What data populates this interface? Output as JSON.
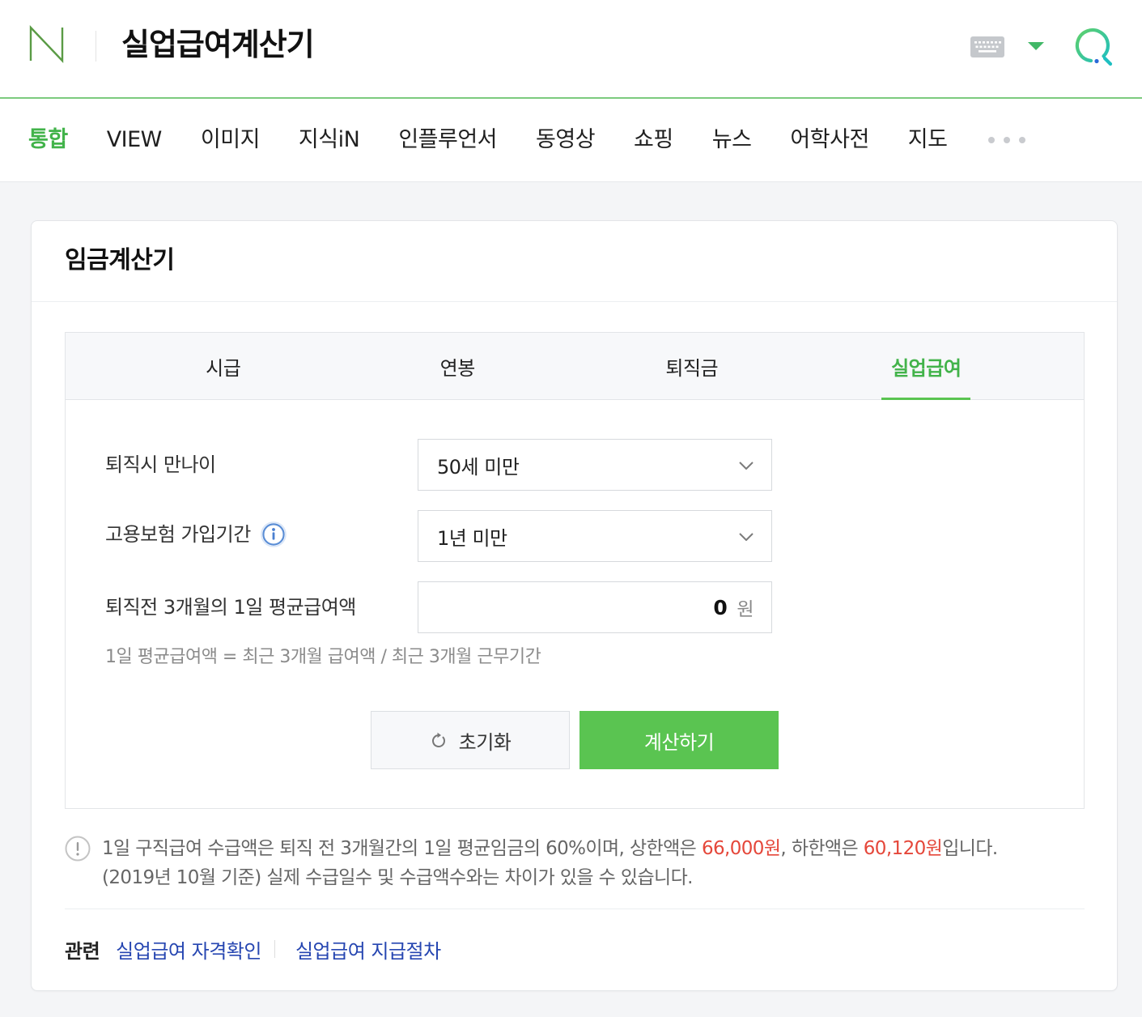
{
  "colors": {
    "accent": "#5ac451",
    "accent_text": "#42b34a",
    "header_line": "#7ccb7e",
    "link": "#2646b1",
    "highlight": "#e5473a"
  },
  "header": {
    "logo_text": "N",
    "logo_icon": "naver-n-logo",
    "title": "실업급여계산기",
    "keyboard_icon": "keyboard-icon",
    "dropdown_icon": "caret-down-icon",
    "search_icon": "search-icon"
  },
  "nav": {
    "items": [
      {
        "label": "통합",
        "active": true
      },
      {
        "label": "VIEW",
        "active": false
      },
      {
        "label": "이미지",
        "active": false
      },
      {
        "label": "지식iN",
        "active": false
      },
      {
        "label": "인플루언서",
        "active": false
      },
      {
        "label": "동영상",
        "active": false
      },
      {
        "label": "쇼핑",
        "active": false
      },
      {
        "label": "뉴스",
        "active": false
      },
      {
        "label": "어학사전",
        "active": false
      },
      {
        "label": "지도",
        "active": false
      }
    ],
    "more_icon": "more-dots-icon"
  },
  "calculator": {
    "title": "임금계산기",
    "tabs": [
      {
        "label": "시급",
        "active": false
      },
      {
        "label": "연봉",
        "active": false
      },
      {
        "label": "퇴직금",
        "active": false
      },
      {
        "label": "실업급여",
        "active": true
      }
    ],
    "form": {
      "age": {
        "label": "퇴직시 만나이",
        "value": "50세 미만",
        "icon": "chevron-down-icon"
      },
      "insurance_period": {
        "label": "고용보험 가입기간",
        "value": "1년 미만",
        "info_icon": "info-icon"
      },
      "daily_wage": {
        "label": "퇴직전 3개월의 1일 평균급여액",
        "value": "0",
        "unit": "원"
      },
      "hint": "1일 평균급여액 = 최근 3개월 급여액 / 최근 3개월 근무기간"
    },
    "buttons": {
      "reset": {
        "label": "초기화",
        "icon": "refresh-icon"
      },
      "calculate": {
        "label": "계산하기"
      }
    },
    "notice": {
      "icon": "exclamation-circle-icon",
      "text_before_max": "1일 구직급여 수급액은 퇴직 전 3개월간의 1일 평균임금의 60%이며, 상한액은 ",
      "max_amount": "66,000원",
      "text_between": ", 하한액은 ",
      "min_amount": "60,120원",
      "text_after_min": "입니다.",
      "second_line": "(2019년 10월 기준) 실제 수급일수 및 수급액수와는 차이가 있을 수 있습니다."
    },
    "related": {
      "label": "관련",
      "links": [
        "실업급여 자격확인",
        "실업급여 지급절차"
      ]
    }
  }
}
